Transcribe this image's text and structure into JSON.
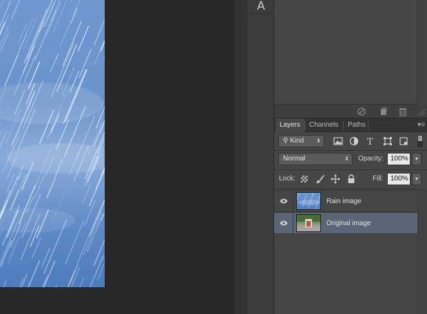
{
  "tool_strip": {
    "type_tool_glyph": "A"
  },
  "panel_footer_icons": [
    "no-entry-icon",
    "new-item-icon",
    "trash-icon",
    "resize-grip-icon"
  ],
  "layers_panel": {
    "tabs": [
      {
        "label": "Layers",
        "active": true
      },
      {
        "label": "Channels",
        "active": false
      },
      {
        "label": "Paths",
        "active": false
      }
    ],
    "filter": {
      "kind_label": "Kind",
      "filter_icons": [
        "image-filter-icon",
        "adjustment-filter-icon",
        "type-filter-icon",
        "shape-filter-icon",
        "smart-object-filter-icon"
      ]
    },
    "blend_mode": "Normal",
    "opacity_label": "Opacity:",
    "opacity_value": "100%",
    "lock_label": "Lock:",
    "lock_icons": [
      "lock-transparent-icon",
      "lock-image-icon",
      "lock-position-icon",
      "lock-all-icon"
    ],
    "fill_label": "Fill:",
    "fill_value": "100%",
    "layers": [
      {
        "name": "Rain image",
        "visible": true,
        "selected": false,
        "thumb": "rain"
      },
      {
        "name": "Original image",
        "visible": true,
        "selected": true,
        "thumb": "orig"
      }
    ]
  },
  "colors": {
    "workspace": "#282828",
    "panel": "#464646",
    "selected_layer": "#5a6577",
    "canvas_blue": "#4a7bc0"
  }
}
